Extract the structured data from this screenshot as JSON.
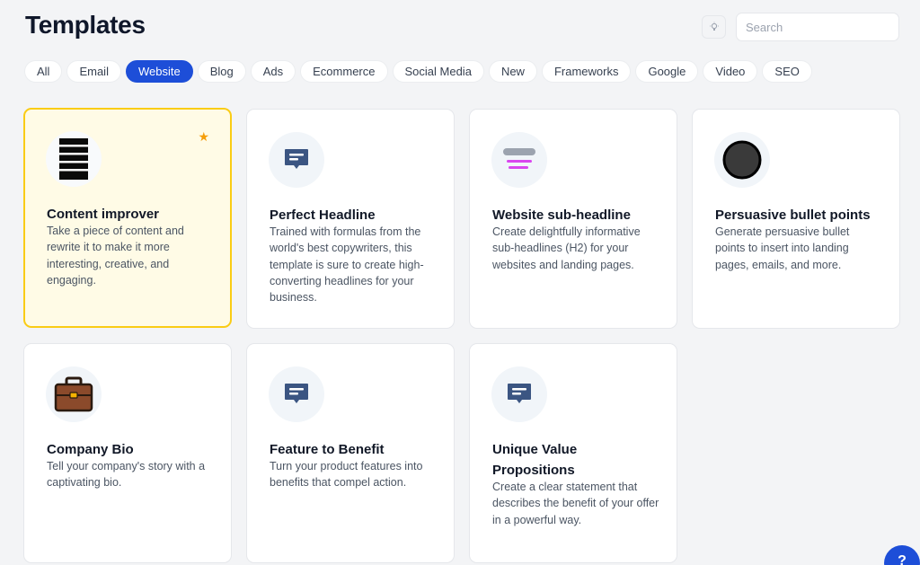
{
  "header": {
    "title": "Templates",
    "search_placeholder": "Search",
    "bulb_icon": "lightbulb-icon"
  },
  "tabs": [
    {
      "label": "All",
      "active": false
    },
    {
      "label": "Email",
      "active": false
    },
    {
      "label": "Website",
      "active": true
    },
    {
      "label": "Blog",
      "active": false
    },
    {
      "label": "Ads",
      "active": false
    },
    {
      "label": "Ecommerce",
      "active": false
    },
    {
      "label": "Social Media",
      "active": false
    },
    {
      "label": "New",
      "active": false
    },
    {
      "label": "Frameworks",
      "active": false
    },
    {
      "label": "Google",
      "active": false
    },
    {
      "label": "Video",
      "active": false
    },
    {
      "label": "SEO",
      "active": false
    }
  ],
  "cards": [
    {
      "title": "Content improver",
      "description": "Take a piece of content and rewrite it to make it more interesting, creative, and engaging.",
      "icon": "striped-lines-icon",
      "starred": true,
      "highlighted": true
    },
    {
      "title": "Perfect Headline",
      "description": "Trained with formulas from the world's best copywriters, this template is sure to create high-converting headlines for your business.",
      "icon": "chat-bubble-icon"
    },
    {
      "title": "Website sub-headline",
      "description": "Create delightfully informative sub-headlines (H2) for your websites and landing pages.",
      "icon": "subheadline-bars-icon"
    },
    {
      "title": "Persuasive bullet points",
      "description": "Generate persuasive bullet points to insert into landing pages, emails, and more.",
      "icon": "black-circle-icon"
    },
    {
      "title": "Company Bio",
      "description": "Tell your company's story with a captivating bio.",
      "icon": "briefcase-icon"
    },
    {
      "title": "Feature to Benefit",
      "description": "Turn your product features into benefits that compel action.",
      "icon": "chat-bubble-icon"
    },
    {
      "title": "Unique Value Propositions",
      "description": "Create a clear statement that describes the benefit of your offer in a powerful way.",
      "icon": "chat-bubble-icon"
    }
  ],
  "help": {
    "label": "?"
  },
  "colors": {
    "accent": "#1d4ed8",
    "highlight_border": "#facc15",
    "highlight_bg": "#fffbe6",
    "star": "#f59e0b",
    "chat_icon": "#3b5582"
  }
}
